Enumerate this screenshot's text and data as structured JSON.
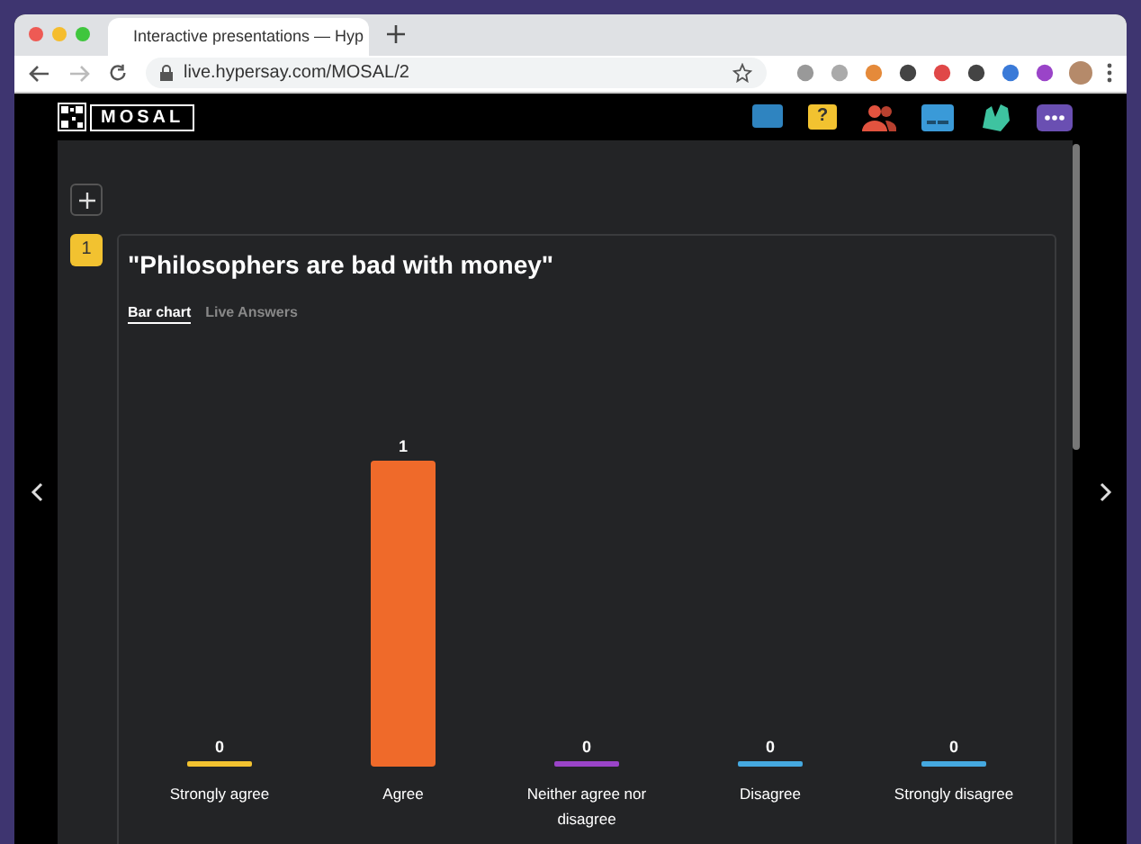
{
  "browser": {
    "tab_title": "Interactive presentations — Hyp",
    "url": "live.hypersay.com/MOSAL/2"
  },
  "app": {
    "logo_text": "MOSAL",
    "question_badge": "?"
  },
  "slide": {
    "number": "1",
    "title": "\"Philosophers are bad with money\"",
    "tabs": [
      {
        "label": "Bar chart",
        "selected": true
      },
      {
        "label": "Live Answers",
        "selected": false
      }
    ],
    "answers": [
      {
        "color": "#f2c230"
      },
      {
        "color": "#ef6a2a"
      },
      {
        "color": "#9a44c8"
      },
      {
        "color": "#45a9e0"
      },
      {
        "color": "#45a9e0"
      }
    ],
    "chart_data": {
      "type": "bar",
      "categories": [
        "Strongly agree",
        "Agree",
        "Neither agree nor disagree",
        "Disagree",
        "Strongly disagree"
      ],
      "values": [
        0,
        1,
        0,
        0,
        0
      ],
      "data_labels": true
    }
  }
}
